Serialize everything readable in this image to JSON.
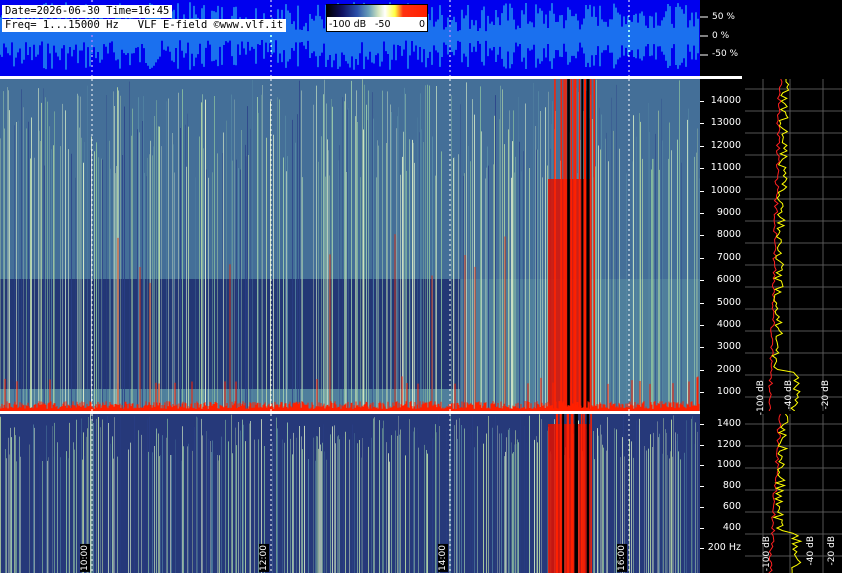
{
  "header": {
    "line1": "Date=2026-06-30 Time=16:45",
    "line2": "Freq= 1...15000 Hz   VLF E-field ©www.vlf.it"
  },
  "colorbar": {
    "labels": [
      "-100 dB",
      "-50",
      "0"
    ]
  },
  "waveform_scale": [
    "50 %",
    "0 %",
    "-50 %"
  ],
  "upper_freq_ticks": [
    "14000",
    "13000",
    "12000",
    "11000",
    "10000",
    "9000",
    "8000",
    "7000",
    "6000",
    "5000",
    "4000",
    "3000",
    "2000",
    "1000"
  ],
  "lower_freq_ticks": [
    "1400",
    "1200",
    "1000",
    "800",
    "600",
    "400",
    "200 Hz"
  ],
  "db_labels": [
    "-100 dB",
    "-40 dB",
    "-20 dB"
  ],
  "time_labels": [
    "10:00",
    "12:00",
    "14:00",
    "16:00"
  ],
  "colors": {
    "waveform_bg": "#0000ee",
    "waveform_fg": "#33e0f0",
    "spectro_bg": "#1c2d6a",
    "spectrum_line": "#ffff00",
    "avg_line": "#ff2020"
  }
}
